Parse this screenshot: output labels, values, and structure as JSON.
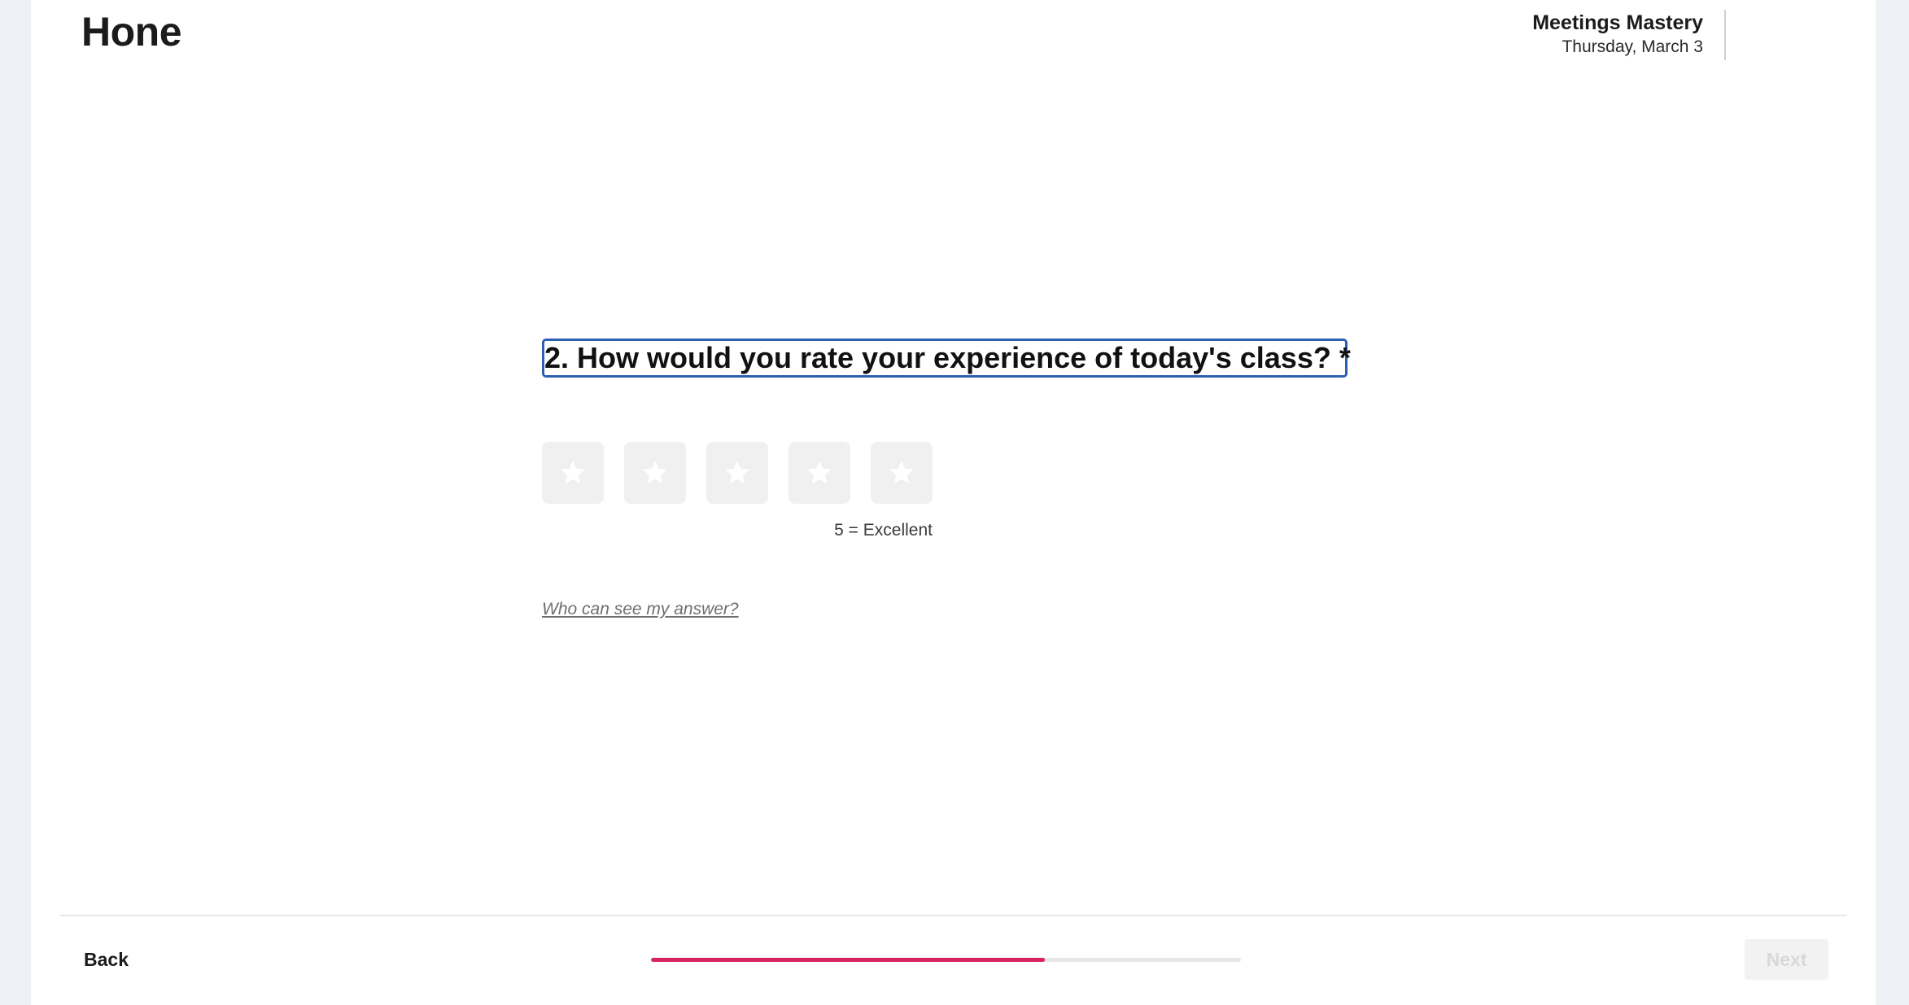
{
  "brand": {
    "logo_text": "Hone"
  },
  "header": {
    "course_title": "Meetings Mastery",
    "date": "Thursday, March 3"
  },
  "question": {
    "text": "2. How would you rate your experience of today's class? *",
    "rating_options": [
      {
        "icon": "star-icon",
        "value": 1
      },
      {
        "icon": "star-icon",
        "value": 2
      },
      {
        "icon": "star-icon",
        "value": 3
      },
      {
        "icon": "star-icon",
        "value": 4
      },
      {
        "icon": "star-icon",
        "value": 5
      }
    ],
    "scale_label": "5 = Excellent",
    "privacy_link": "Who can see my answer?"
  },
  "footer": {
    "back_label": "Back",
    "next_label": "Next",
    "progress_fraction": 0.667
  },
  "colors": {
    "accent": "#d6245f",
    "focus": "#2f5fb3",
    "background": "#eef2f7"
  }
}
